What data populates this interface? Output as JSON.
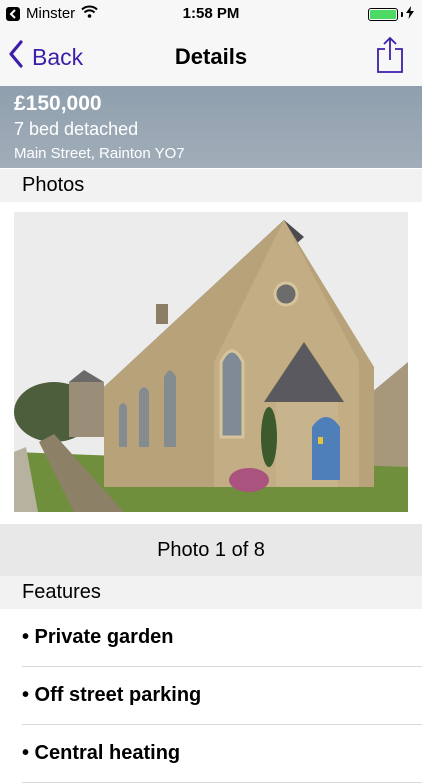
{
  "status_bar": {
    "carrier": "Minster",
    "time": "1:58 PM",
    "battery_level": 1.0,
    "icons": [
      "back-to-app-icon",
      "wifi-icon",
      "battery-icon",
      "charging-bolt-icon"
    ]
  },
  "nav": {
    "back_label": "Back",
    "title": "Details",
    "share_icon": "share-icon"
  },
  "listing": {
    "price": "£150,000",
    "type": "7 bed detached",
    "address": "Main Street, Rainton YO7"
  },
  "photos": {
    "section_title": "Photos",
    "counter": "Photo 1 of 8",
    "current": 1,
    "total": 8
  },
  "features": {
    "section_title": "Features",
    "items": [
      "• Private garden",
      "• Off street parking",
      "• Central heating"
    ]
  },
  "colors": {
    "accent": "#3d1eaa",
    "banner": "#98a6b3",
    "battery": "#4cd964"
  }
}
